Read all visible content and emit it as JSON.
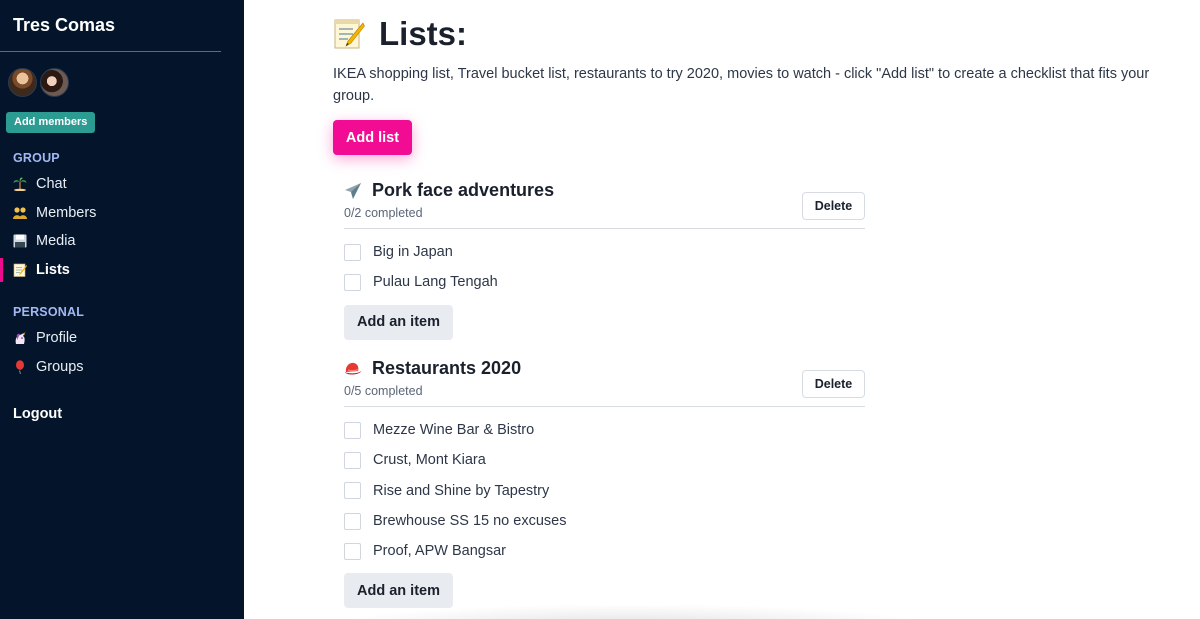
{
  "sidebar": {
    "brand": "Tres Comas",
    "add_members_label": "Add members",
    "group_label": "GROUP",
    "personal_label": "PERSONAL",
    "group_items": [
      {
        "label": "Chat",
        "icon": "palm-tree-icon"
      },
      {
        "label": "Members",
        "icon": "people-icon"
      },
      {
        "label": "Media",
        "icon": "floppy-disk-icon"
      },
      {
        "label": "Lists",
        "icon": "memo-icon",
        "active": true
      }
    ],
    "personal_items": [
      {
        "label": "Profile",
        "icon": "unicorn-icon"
      },
      {
        "label": "Groups",
        "icon": "balloon-icon"
      }
    ],
    "logout_label": "Logout"
  },
  "main": {
    "title": "Lists:",
    "title_icon": "memo-icon",
    "intro": "IKEA shopping list, Travel bucket list, restaurants to try 2020, movies to watch - click \"Add list\" to create a checklist that fits your group.",
    "add_list_label": "Add list",
    "delete_label": "Delete",
    "add_item_label": "Add an item",
    "lists": [
      {
        "title": "Pork face adventures",
        "icon": "airplane-icon",
        "progress": "0/2 completed",
        "items": [
          "Big in Japan",
          "Pulau Lang Tengah"
        ]
      },
      {
        "title": "Restaurants 2020",
        "icon": "red-hat-icon",
        "progress": "0/5 completed",
        "items": [
          "Mezze Wine Bar & Bistro",
          "Crust, Mont Kiara",
          "Rise and Shine by Tapestry",
          "Brewhouse SS 15 no excuses",
          "Proof, APW Bangsar"
        ]
      }
    ]
  },
  "colors": {
    "sidebar_bg": "#04152b",
    "accent_pink": "#f20c93",
    "teal_button": "#2c9c93",
    "section_label": "#a3b8f2"
  }
}
